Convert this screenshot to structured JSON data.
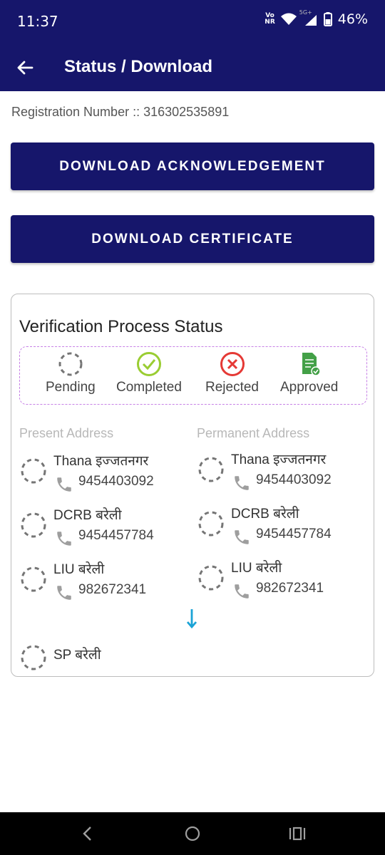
{
  "status_bar": {
    "time": "11:37",
    "volte_top": "Vo",
    "volte_bottom": "NR",
    "network": "5G+",
    "battery": "46%"
  },
  "app_bar": {
    "title": "Status / Download",
    "back_icon": "arrow-left-icon"
  },
  "registration": {
    "label": "Registration Number ::",
    "value": "316302535891"
  },
  "buttons": {
    "acknowledgement": "DOWNLOAD ACKNOWLEDGEMENT",
    "certificate": "DOWNLOAD CERTIFICATE"
  },
  "verification": {
    "title": "Verification Process Status",
    "legend": [
      {
        "label": "Pending",
        "icon": "pending-spinner-icon"
      },
      {
        "label": "Completed",
        "icon": "check-circle-icon"
      },
      {
        "label": "Rejected",
        "icon": "x-circle-icon"
      },
      {
        "label": "Approved",
        "icon": "approved-document-icon"
      }
    ],
    "present_header": "Present Address",
    "permanent_header": "Permanent Address",
    "present": [
      {
        "name": "Thana इज्जतनगर",
        "phone": "9454403092"
      },
      {
        "name": "DCRB बरेली",
        "phone": "9454457784"
      },
      {
        "name": "LIU बरेली",
        "phone": "982672341"
      }
    ],
    "permanent": [
      {
        "name": "Thana इज्जतनगर",
        "phone": "9454403092"
      },
      {
        "name": "DCRB बरेली",
        "phone": "9454457784"
      },
      {
        "name": "LIU बरेली",
        "phone": "982672341"
      }
    ],
    "final": {
      "name": "SP बरेली"
    }
  },
  "colors": {
    "primary": "#16166b",
    "completed": "#9acd32",
    "rejected": "#e53935",
    "approved": "#43a047",
    "pending": "#757575",
    "arrow": "#1ba3d6"
  }
}
